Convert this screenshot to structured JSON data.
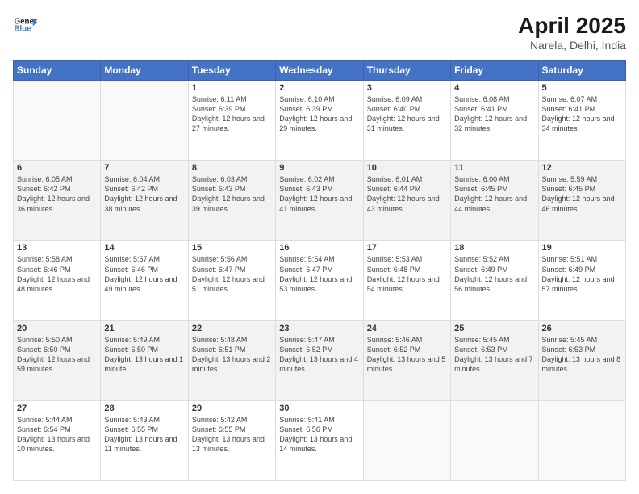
{
  "header": {
    "logo_line1": "General",
    "logo_line2": "Blue",
    "title": "April 2025",
    "subtitle": "Narela, Delhi, India"
  },
  "days_of_week": [
    "Sunday",
    "Monday",
    "Tuesday",
    "Wednesday",
    "Thursday",
    "Friday",
    "Saturday"
  ],
  "weeks": [
    [
      {
        "day": "",
        "sunrise": "",
        "sunset": "",
        "daylight": ""
      },
      {
        "day": "",
        "sunrise": "",
        "sunset": "",
        "daylight": ""
      },
      {
        "day": "1",
        "sunrise": "Sunrise: 6:11 AM",
        "sunset": "Sunset: 6:39 PM",
        "daylight": "Daylight: 12 hours and 27 minutes."
      },
      {
        "day": "2",
        "sunrise": "Sunrise: 6:10 AM",
        "sunset": "Sunset: 6:39 PM",
        "daylight": "Daylight: 12 hours and 29 minutes."
      },
      {
        "day": "3",
        "sunrise": "Sunrise: 6:09 AM",
        "sunset": "Sunset: 6:40 PM",
        "daylight": "Daylight: 12 hours and 31 minutes."
      },
      {
        "day": "4",
        "sunrise": "Sunrise: 6:08 AM",
        "sunset": "Sunset: 6:41 PM",
        "daylight": "Daylight: 12 hours and 32 minutes."
      },
      {
        "day": "5",
        "sunrise": "Sunrise: 6:07 AM",
        "sunset": "Sunset: 6:41 PM",
        "daylight": "Daylight: 12 hours and 34 minutes."
      }
    ],
    [
      {
        "day": "6",
        "sunrise": "Sunrise: 6:05 AM",
        "sunset": "Sunset: 6:42 PM",
        "daylight": "Daylight: 12 hours and 36 minutes."
      },
      {
        "day": "7",
        "sunrise": "Sunrise: 6:04 AM",
        "sunset": "Sunset: 6:42 PM",
        "daylight": "Daylight: 12 hours and 38 minutes."
      },
      {
        "day": "8",
        "sunrise": "Sunrise: 6:03 AM",
        "sunset": "Sunset: 6:43 PM",
        "daylight": "Daylight: 12 hours and 39 minutes."
      },
      {
        "day": "9",
        "sunrise": "Sunrise: 6:02 AM",
        "sunset": "Sunset: 6:43 PM",
        "daylight": "Daylight: 12 hours and 41 minutes."
      },
      {
        "day": "10",
        "sunrise": "Sunrise: 6:01 AM",
        "sunset": "Sunset: 6:44 PM",
        "daylight": "Daylight: 12 hours and 43 minutes."
      },
      {
        "day": "11",
        "sunrise": "Sunrise: 6:00 AM",
        "sunset": "Sunset: 6:45 PM",
        "daylight": "Daylight: 12 hours and 44 minutes."
      },
      {
        "day": "12",
        "sunrise": "Sunrise: 5:59 AM",
        "sunset": "Sunset: 6:45 PM",
        "daylight": "Daylight: 12 hours and 46 minutes."
      }
    ],
    [
      {
        "day": "13",
        "sunrise": "Sunrise: 5:58 AM",
        "sunset": "Sunset: 6:46 PM",
        "daylight": "Daylight: 12 hours and 48 minutes."
      },
      {
        "day": "14",
        "sunrise": "Sunrise: 5:57 AM",
        "sunset": "Sunset: 6:46 PM",
        "daylight": "Daylight: 12 hours and 49 minutes."
      },
      {
        "day": "15",
        "sunrise": "Sunrise: 5:56 AM",
        "sunset": "Sunset: 6:47 PM",
        "daylight": "Daylight: 12 hours and 51 minutes."
      },
      {
        "day": "16",
        "sunrise": "Sunrise: 5:54 AM",
        "sunset": "Sunset: 6:47 PM",
        "daylight": "Daylight: 12 hours and 53 minutes."
      },
      {
        "day": "17",
        "sunrise": "Sunrise: 5:53 AM",
        "sunset": "Sunset: 6:48 PM",
        "daylight": "Daylight: 12 hours and 54 minutes."
      },
      {
        "day": "18",
        "sunrise": "Sunrise: 5:52 AM",
        "sunset": "Sunset: 6:49 PM",
        "daylight": "Daylight: 12 hours and 56 minutes."
      },
      {
        "day": "19",
        "sunrise": "Sunrise: 5:51 AM",
        "sunset": "Sunset: 6:49 PM",
        "daylight": "Daylight: 12 hours and 57 minutes."
      }
    ],
    [
      {
        "day": "20",
        "sunrise": "Sunrise: 5:50 AM",
        "sunset": "Sunset: 6:50 PM",
        "daylight": "Daylight: 12 hours and 59 minutes."
      },
      {
        "day": "21",
        "sunrise": "Sunrise: 5:49 AM",
        "sunset": "Sunset: 6:50 PM",
        "daylight": "Daylight: 13 hours and 1 minute."
      },
      {
        "day": "22",
        "sunrise": "Sunrise: 5:48 AM",
        "sunset": "Sunset: 6:51 PM",
        "daylight": "Daylight: 13 hours and 2 minutes."
      },
      {
        "day": "23",
        "sunrise": "Sunrise: 5:47 AM",
        "sunset": "Sunset: 6:52 PM",
        "daylight": "Daylight: 13 hours and 4 minutes."
      },
      {
        "day": "24",
        "sunrise": "Sunrise: 5:46 AM",
        "sunset": "Sunset: 6:52 PM",
        "daylight": "Daylight: 13 hours and 5 minutes."
      },
      {
        "day": "25",
        "sunrise": "Sunrise: 5:45 AM",
        "sunset": "Sunset: 6:53 PM",
        "daylight": "Daylight: 13 hours and 7 minutes."
      },
      {
        "day": "26",
        "sunrise": "Sunrise: 5:45 AM",
        "sunset": "Sunset: 6:53 PM",
        "daylight": "Daylight: 13 hours and 8 minutes."
      }
    ],
    [
      {
        "day": "27",
        "sunrise": "Sunrise: 5:44 AM",
        "sunset": "Sunset: 6:54 PM",
        "daylight": "Daylight: 13 hours and 10 minutes."
      },
      {
        "day": "28",
        "sunrise": "Sunrise: 5:43 AM",
        "sunset": "Sunset: 6:55 PM",
        "daylight": "Daylight: 13 hours and 11 minutes."
      },
      {
        "day": "29",
        "sunrise": "Sunrise: 5:42 AM",
        "sunset": "Sunset: 6:55 PM",
        "daylight": "Daylight: 13 hours and 13 minutes."
      },
      {
        "day": "30",
        "sunrise": "Sunrise: 5:41 AM",
        "sunset": "Sunset: 6:56 PM",
        "daylight": "Daylight: 13 hours and 14 minutes."
      },
      {
        "day": "",
        "sunrise": "",
        "sunset": "",
        "daylight": ""
      },
      {
        "day": "",
        "sunrise": "",
        "sunset": "",
        "daylight": ""
      },
      {
        "day": "",
        "sunrise": "",
        "sunset": "",
        "daylight": ""
      }
    ]
  ]
}
